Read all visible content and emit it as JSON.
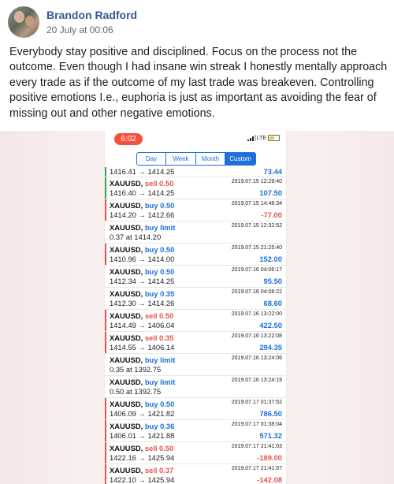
{
  "post": {
    "author": "Brandon Radford",
    "timestamp": "20 July at 00:06",
    "text": "Everybody stay positive and disciplined. Focus on the process not the outcome. Even though I had insane win streak I honestly mentally approach every trade as if the outcome of my last trade was breakeven. Controlling positive emotions I.e., euphoria is just as important as avoiding the fear of missing out and other negative emotions."
  },
  "phone": {
    "time": "6:02",
    "network": "LTE",
    "tabs": [
      {
        "label": "Day"
      },
      {
        "label": "Week"
      },
      {
        "label": "Month"
      },
      {
        "label": "Custom"
      }
    ],
    "selected_tab": "Custom"
  },
  "trades": [
    {
      "symbol": "",
      "side": "",
      "detail": "1416.41 → 1414.25",
      "datetime": "",
      "profit": "73.44"
    },
    {
      "symbol": "XAUUSD,",
      "side": "sell 0.50",
      "detail": "1416.40 → 1414.25",
      "datetime": "2019.07.15 12:29:40",
      "profit": "107.50"
    },
    {
      "symbol": "XAUUSD,",
      "side": "buy 0.50",
      "detail": "1414.20 → 1412.66",
      "datetime": "2019.07.15 14:48:34",
      "profit": "-77.00"
    },
    {
      "symbol": "XAUUSD,",
      "side": "buy limit",
      "detail": "0.37 at 1414.20",
      "datetime": "2019.07.15 12:32:52",
      "profit": ""
    },
    {
      "symbol": "XAUUSD,",
      "side": "buy 0.50",
      "detail": "1410.96 → 1414.00",
      "datetime": "2019.07.15 21:25:40",
      "profit": "152.00"
    },
    {
      "symbol": "XAUUSD,",
      "side": "buy 0.50",
      "detail": "1412.34 → 1414.25",
      "datetime": "2019.07.16 04:06:17",
      "profit": "95.50"
    },
    {
      "symbol": "XAUUSD,",
      "side": "buy 0.35",
      "detail": "1412.30 → 1414.26",
      "datetime": "2019.07.16 04:08:22",
      "profit": "68.60"
    },
    {
      "symbol": "XAUUSD,",
      "side": "sell 0.50",
      "detail": "1414.49 → 1406.04",
      "datetime": "2019.07.16 13:22:00",
      "profit": "422.50"
    },
    {
      "symbol": "XAUUSD,",
      "side": "sell 0.35",
      "detail": "1414.55 → 1406.14",
      "datetime": "2019.07.16 13:22:08",
      "profit": "294.35"
    },
    {
      "symbol": "XAUUSD,",
      "side": "buy limit",
      "detail": "0.35 at 1392.75",
      "datetime": "2019.07.16 13:24:06",
      "profit": ""
    },
    {
      "symbol": "XAUUSD,",
      "side": "buy limit",
      "detail": "0.50 at 1392.75",
      "datetime": "2019.07.16 13:24:19",
      "profit": ""
    },
    {
      "symbol": "XAUUSD,",
      "side": "buy 0.50",
      "detail": "1406.09 → 1421.82",
      "datetime": "2019.07.17 01:37:52",
      "profit": "786.50"
    },
    {
      "symbol": "XAUUSD,",
      "side": "buy 0.36",
      "detail": "1406.01 → 1421.88",
      "datetime": "2019.07.17 01:38:04",
      "profit": "571.32"
    },
    {
      "symbol": "XAUUSD,",
      "side": "sell 0.50",
      "detail": "1422.16 → 1425.94",
      "datetime": "2019.07.17 21:41:03",
      "profit": "-189.00"
    },
    {
      "symbol": "XAUUSD,",
      "side": "sell 0.37",
      "detail": "1422.10 → 1425.94",
      "datetime": "2019.07.17 21:41:07",
      "profit": "-142.08"
    }
  ],
  "colors": {
    "facebook_blue": "#385898",
    "ios_blue": "#1e6fd9",
    "sell_red": "#e2554a",
    "profit_blue": "#1e6fd9",
    "loss_red": "#e2554a",
    "green_marker": "#2ea84a"
  }
}
